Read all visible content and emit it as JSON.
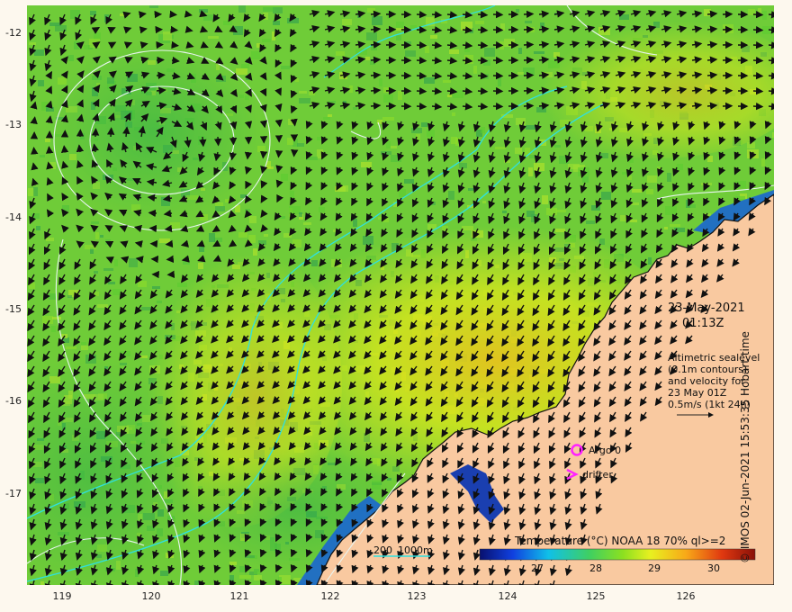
{
  "date_label": "23-May-2021",
  "time_label": "01:13Z",
  "note_lines": [
    "Altimetric sealevel",
    "(0.1m contours)",
    "and velocity for",
    "23 May 01Z",
    "0.5m/s (1kt 24h)"
  ],
  "legend": {
    "argo": "Argo 0",
    "drifter": "drifter",
    "scale_label_a": "200",
    "scale_label_b": "1000m"
  },
  "colorbar": {
    "title": "Temperature (°C) NOAA 18 70% ql>=2",
    "ticks": [
      "27",
      "28",
      "29",
      "30"
    ]
  },
  "credit": "© IMOS 02-Jun-2021 15:53:35 Hobart time",
  "axes": {
    "y_ticks": [
      "-12",
      "-13",
      "-14",
      "-15",
      "-16",
      "-17"
    ],
    "x_ticks": [
      "119",
      "120",
      "121",
      "122",
      "123",
      "124",
      "125",
      "126"
    ]
  },
  "colors": {
    "land": "#f9c9a0",
    "ocean_base": "#7fd23a",
    "contour": "#e8f4f0",
    "isobath": "#2ee0e0",
    "argo": "#ff22ff",
    "arrow": "#111111"
  }
}
